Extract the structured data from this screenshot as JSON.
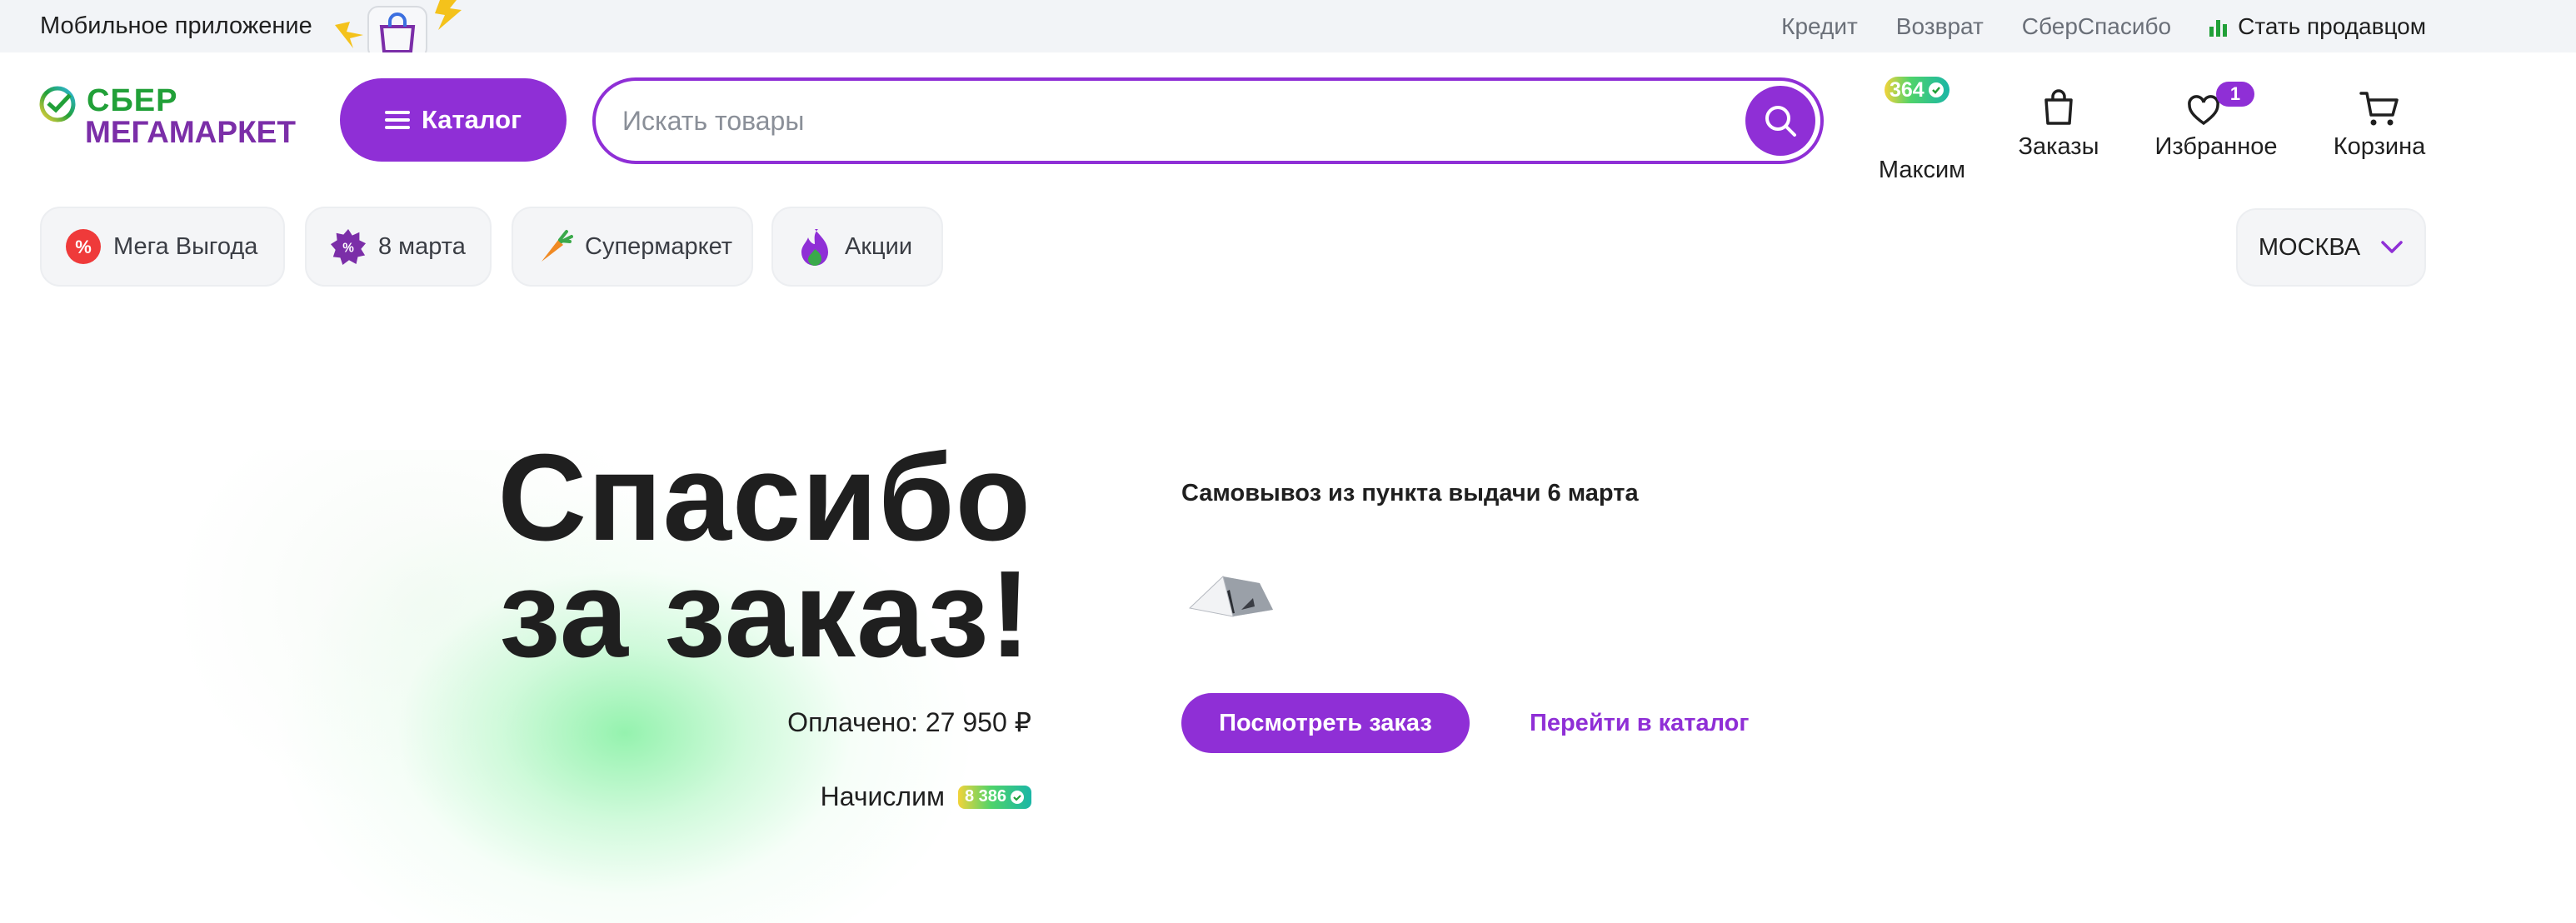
{
  "topbar": {
    "app_label": "Мобильное приложение",
    "links": [
      "Кредит",
      "Возврат",
      "СберСпасибо"
    ],
    "seller_label": "Стать продавцом"
  },
  "logo": {
    "line1": "СБЕР",
    "line2": "МЕГАМАРКЕТ"
  },
  "header": {
    "catalog_label": "Каталог",
    "search_placeholder": "Искать товары",
    "profile": {
      "label": "Максим",
      "bonus": "364"
    },
    "orders_label": "Заказы",
    "favorites": {
      "label": "Избранное",
      "count": "1"
    },
    "cart_label": "Корзина"
  },
  "chips": [
    {
      "label": "Мега Выгода",
      "icon": "percent-icon"
    },
    {
      "label": "8 марта",
      "icon": "sale-burst-icon"
    },
    {
      "label": "Супермаркет",
      "icon": "carrot-icon"
    },
    {
      "label": "Акции",
      "icon": "flame-icon"
    }
  ],
  "city": {
    "label": "МОСКВА"
  },
  "order": {
    "title_line1": "Спасибо",
    "title_line2": "за заказ!",
    "paid": "Оплачено: 27 950 ₽",
    "accrue_label": "Начислим",
    "accrue_bonus": "8 386",
    "pickup": "Самовывоз из пункта выдачи 6 марта",
    "view_order": "Посмотреть заказ",
    "go_catalog": "Перейти в каталог"
  },
  "colors": {
    "accent": "#8f2fd6",
    "sber_green": "#21a038",
    "logo_purple": "#7b2ea8",
    "seller_icon": "#21a038"
  }
}
